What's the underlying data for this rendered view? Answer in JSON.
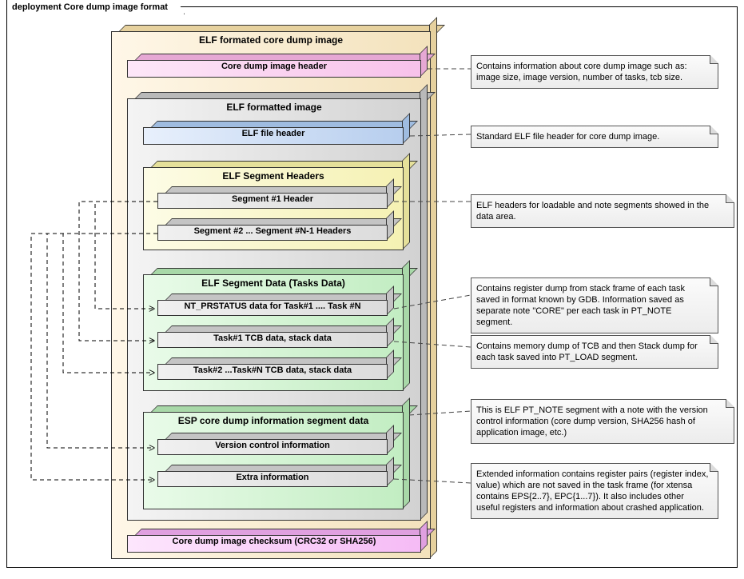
{
  "frame_title": "deployment Core dump image format",
  "outer": {
    "title": "ELF formated core dump image",
    "header_box": "Core dump image header",
    "checksum_box": "Core dump image checksum (CRC32 or SHA256)"
  },
  "elf_image": {
    "title": "ELF formatted image",
    "file_header": "ELF file header",
    "seg_headers": {
      "title": "ELF Segment Headers",
      "seg1": "Segment #1 Header",
      "segN": "Segment #2 ... Segment #N-1 Headers"
    },
    "seg_data": {
      "title": "ELF Segment Data (Tasks Data)",
      "nt_prstatus": "NT_PRSTATUS data for Task#1 .... Task #N",
      "task1_tcb": "Task#1 TCB data, stack data",
      "taskN_tcb": "Task#2 ...Task#N TCB data,  stack data"
    },
    "esp_info": {
      "title": "ESP core dump information segment data",
      "version": "Version control information",
      "extra": "Extra information"
    }
  },
  "notes": {
    "header": "Contains information about core dump image such as: image size, image version, number of tasks, tcb size.",
    "elf_header": "Standard ELF file header for core dump image.",
    "seg_headers": "ELF headers for loadable and note segments showed in the data area.",
    "seg_data": "Contains register dump from stack frame of each task saved in format known by GDB. Information saved as separate note \"CORE\" per each task in PT_NOTE segment.",
    "tcb": "Contains memory dump of TCB and then Stack dump for each task saved into PT_LOAD segment.",
    "esp": "This is ELF PT_NOTE segment with a note with the version control information (core dump version, SHA256 hash of application image, etc.)",
    "extra": "Extended information contains register pairs (register index, value) which are not saved in the task frame (for xtensa contains EPS{2..7}, EPC{1...7}). It also includes other useful registers and information about crashed application."
  }
}
